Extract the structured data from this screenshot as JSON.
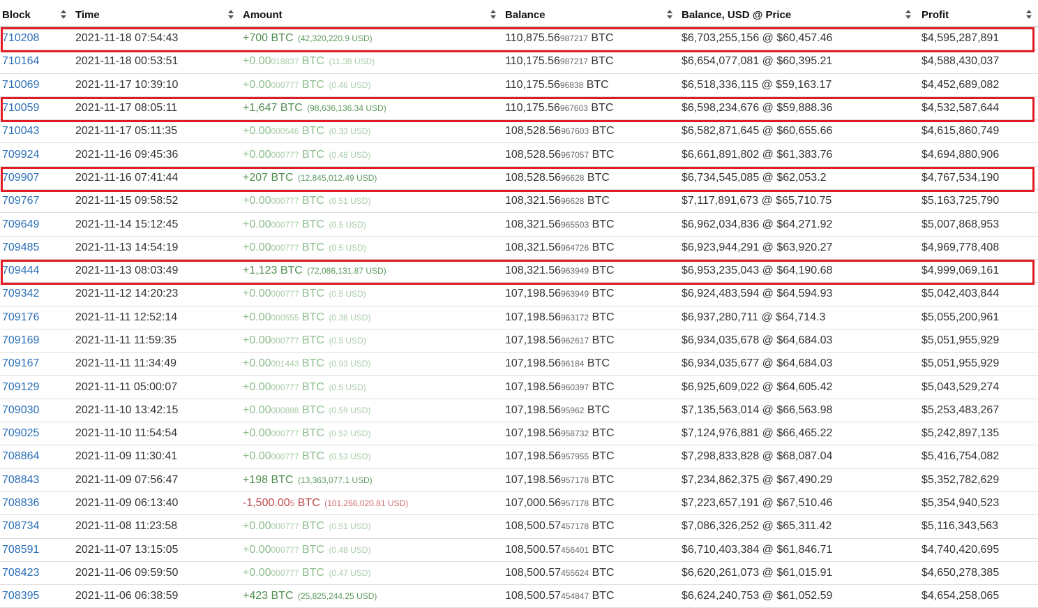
{
  "columns": [
    {
      "key": "block",
      "label": "Block"
    },
    {
      "key": "time",
      "label": "Time"
    },
    {
      "key": "amount",
      "label": "Amount"
    },
    {
      "key": "balance",
      "label": "Balance"
    },
    {
      "key": "usd",
      "label": "Balance, USD @ Price"
    },
    {
      "key": "profit",
      "label": "Profit"
    }
  ],
  "colors": {
    "link": "#2a6fb8",
    "positive": "#4f8d4f",
    "negative": "#c0494c",
    "highlight": "#e01b24"
  },
  "rows": [
    {
      "block": "710208",
      "time": "2021-11-18 07:54:43",
      "amt_main": "+700",
      "amt_small": "",
      "amt_unit": " BTC",
      "amt_usd": "(42,320,220.9 USD)",
      "kind": "big-pos",
      "bal_main": "110,875.56",
      "bal_small": "987217",
      "bal_unit": " BTC",
      "usd": "$6,703,255,156 @ $60,457.46",
      "profit": "$4,595,287,891",
      "highlighted": true
    },
    {
      "block": "710164",
      "time": "2021-11-18 00:53:51",
      "amt_main": "+0.00",
      "amt_small": "018837",
      "amt_unit": " BTC",
      "amt_usd": "(11.38 USD)",
      "kind": "dust-pos",
      "bal_main": "110,175.56",
      "bal_small": "987217",
      "bal_unit": " BTC",
      "usd": "$6,654,077,081 @ $60,395.21",
      "profit": "$4,588,430,037",
      "highlighted": false
    },
    {
      "block": "710069",
      "time": "2021-11-17 10:39:10",
      "amt_main": "+0.00",
      "amt_small": "000777",
      "amt_unit": " BTC",
      "amt_usd": "(0.46 USD)",
      "kind": "dust-pos",
      "bal_main": "110,175.56",
      "bal_small": "96838",
      "bal_unit": " BTC",
      "usd": "$6,518,336,115 @ $59,163.17",
      "profit": "$4,452,689,082",
      "highlighted": false
    },
    {
      "block": "710059",
      "time": "2021-11-17 08:05:11",
      "amt_main": "+1,647",
      "amt_small": "",
      "amt_unit": " BTC",
      "amt_usd": "(98,636,136.34 USD)",
      "kind": "big-pos",
      "bal_main": "110,175.56",
      "bal_small": "967603",
      "bal_unit": " BTC",
      "usd": "$6,598,234,676 @ $59,888.36",
      "profit": "$4,532,587,644",
      "highlighted": true
    },
    {
      "block": "710043",
      "time": "2021-11-17 05:11:35",
      "amt_main": "+0.00",
      "amt_small": "000546",
      "amt_unit": " BTC",
      "amt_usd": "(0.33 USD)",
      "kind": "dust-pos",
      "bal_main": "108,528.56",
      "bal_small": "967603",
      "bal_unit": " BTC",
      "usd": "$6,582,871,645 @ $60,655.66",
      "profit": "$4,615,860,749",
      "highlighted": false
    },
    {
      "block": "709924",
      "time": "2021-11-16 09:45:36",
      "amt_main": "+0.00",
      "amt_small": "000777",
      "amt_unit": " BTC",
      "amt_usd": "(0.48 USD)",
      "kind": "dust-pos",
      "bal_main": "108,528.56",
      "bal_small": "967057",
      "bal_unit": " BTC",
      "usd": "$6,661,891,802 @ $61,383.76",
      "profit": "$4,694,880,906",
      "highlighted": false
    },
    {
      "block": "709907",
      "time": "2021-11-16 07:41:44",
      "amt_main": "+207",
      "amt_small": "",
      "amt_unit": " BTC",
      "amt_usd": "(12,845,012.49 USD)",
      "kind": "big-pos",
      "bal_main": "108,528.56",
      "bal_small": "96628",
      "bal_unit": " BTC",
      "usd": "$6,734,545,085 @ $62,053.2",
      "profit": "$4,767,534,190",
      "highlighted": true
    },
    {
      "block": "709767",
      "time": "2021-11-15 09:58:52",
      "amt_main": "+0.00",
      "amt_small": "000777",
      "amt_unit": " BTC",
      "amt_usd": "(0.51 USD)",
      "kind": "dust-pos",
      "bal_main": "108,321.56",
      "bal_small": "96628",
      "bal_unit": " BTC",
      "usd": "$7,117,891,673 @ $65,710.75",
      "profit": "$5,163,725,790",
      "highlighted": false
    },
    {
      "block": "709649",
      "time": "2021-11-14 15:12:45",
      "amt_main": "+0.00",
      "amt_small": "000777",
      "amt_unit": " BTC",
      "amt_usd": "(0.5 USD)",
      "kind": "dust-pos",
      "bal_main": "108,321.56",
      "bal_small": "965503",
      "bal_unit": " BTC",
      "usd": "$6,962,034,836 @ $64,271.92",
      "profit": "$5,007,868,953",
      "highlighted": false
    },
    {
      "block": "709485",
      "time": "2021-11-13 14:54:19",
      "amt_main": "+0.00",
      "amt_small": "000777",
      "amt_unit": " BTC",
      "amt_usd": "(0.5 USD)",
      "kind": "dust-pos",
      "bal_main": "108,321.56",
      "bal_small": "964726",
      "bal_unit": " BTC",
      "usd": "$6,923,944,291 @ $63,920.27",
      "profit": "$4,969,778,408",
      "highlighted": false
    },
    {
      "block": "709444",
      "time": "2021-11-13 08:03:49",
      "amt_main": "+1,123",
      "amt_small": "",
      "amt_unit": " BTC",
      "amt_usd": "(72,086,131.87 USD)",
      "kind": "big-pos",
      "bal_main": "108,321.56",
      "bal_small": "963949",
      "bal_unit": " BTC",
      "usd": "$6,953,235,043 @ $64,190.68",
      "profit": "$4,999,069,161",
      "highlighted": true
    },
    {
      "block": "709342",
      "time": "2021-11-12 14:20:23",
      "amt_main": "+0.00",
      "amt_small": "000777",
      "amt_unit": " BTC",
      "amt_usd": "(0.5 USD)",
      "kind": "dust-pos",
      "bal_main": "107,198.56",
      "bal_small": "963949",
      "bal_unit": " BTC",
      "usd": "$6,924,483,594 @ $64,594.93",
      "profit": "$5,042,403,844",
      "highlighted": false
    },
    {
      "block": "709176",
      "time": "2021-11-11 12:52:14",
      "amt_main": "+0.00",
      "amt_small": "000555",
      "amt_unit": " BTC",
      "amt_usd": "(0.36 USD)",
      "kind": "dust-pos",
      "bal_main": "107,198.56",
      "bal_small": "963172",
      "bal_unit": " BTC",
      "usd": "$6,937,280,711 @ $64,714.3",
      "profit": "$5,055,200,961",
      "highlighted": false
    },
    {
      "block": "709169",
      "time": "2021-11-11 11:59:35",
      "amt_main": "+0.00",
      "amt_small": "000777",
      "amt_unit": " BTC",
      "amt_usd": "(0.5 USD)",
      "kind": "dust-pos",
      "bal_main": "107,198.56",
      "bal_small": "962617",
      "bal_unit": " BTC",
      "usd": "$6,934,035,678 @ $64,684.03",
      "profit": "$5,051,955,929",
      "highlighted": false
    },
    {
      "block": "709167",
      "time": "2021-11-11 11:34:49",
      "amt_main": "+0.00",
      "amt_small": "001443",
      "amt_unit": " BTC",
      "amt_usd": "(0.93 USD)",
      "kind": "dust-pos",
      "bal_main": "107,198.56",
      "bal_small": "96184",
      "bal_unit": " BTC",
      "usd": "$6,934,035,677 @ $64,684.03",
      "profit": "$5,051,955,929",
      "highlighted": false
    },
    {
      "block": "709129",
      "time": "2021-11-11 05:00:07",
      "amt_main": "+0.00",
      "amt_small": "000777",
      "amt_unit": " BTC",
      "amt_usd": "(0.5 USD)",
      "kind": "dust-pos",
      "bal_main": "107,198.56",
      "bal_small": "960397",
      "bal_unit": " BTC",
      "usd": "$6,925,609,022 @ $64,605.42",
      "profit": "$5,043,529,274",
      "highlighted": false
    },
    {
      "block": "709030",
      "time": "2021-11-10 13:42:15",
      "amt_main": "+0.00",
      "amt_small": "000888",
      "amt_unit": " BTC",
      "amt_usd": "(0.59 USD)",
      "kind": "dust-pos",
      "bal_main": "107,198.56",
      "bal_small": "95962",
      "bal_unit": " BTC",
      "usd": "$7,135,563,014 @ $66,563.98",
      "profit": "$5,253,483,267",
      "highlighted": false
    },
    {
      "block": "709025",
      "time": "2021-11-10 11:54:54",
      "amt_main": "+0.00",
      "amt_small": "000777",
      "amt_unit": " BTC",
      "amt_usd": "(0.52 USD)",
      "kind": "dust-pos",
      "bal_main": "107,198.56",
      "bal_small": "958732",
      "bal_unit": " BTC",
      "usd": "$7,124,976,881 @ $66,465.22",
      "profit": "$5,242,897,135",
      "highlighted": false
    },
    {
      "block": "708864",
      "time": "2021-11-09 11:30:41",
      "amt_main": "+0.00",
      "amt_small": "000777",
      "amt_unit": " BTC",
      "amt_usd": "(0.53 USD)",
      "kind": "dust-pos",
      "bal_main": "107,198.56",
      "bal_small": "957955",
      "bal_unit": " BTC",
      "usd": "$7,298,833,828 @ $68,087.04",
      "profit": "$5,416,754,082",
      "highlighted": false
    },
    {
      "block": "708843",
      "time": "2021-11-09 07:56:47",
      "amt_main": "+198",
      "amt_small": "",
      "amt_unit": " BTC",
      "amt_usd": "(13,363,077.1 USD)",
      "kind": "big-pos",
      "bal_main": "107,198.56",
      "bal_small": "957178",
      "bal_unit": " BTC",
      "usd": "$7,234,862,375 @ $67,490.29",
      "profit": "$5,352,782,629",
      "highlighted": false
    },
    {
      "block": "708836",
      "time": "2021-11-09 06:13:40",
      "amt_main": "-1,500.00",
      "amt_small": "5",
      "amt_unit": " BTC",
      "amt_usd": "(101,266,020.81 USD)",
      "kind": "neg",
      "bal_main": "107,000.56",
      "bal_small": "957178",
      "bal_unit": " BTC",
      "usd": "$7,223,657,191 @ $67,510.46",
      "profit": "$5,354,940,523",
      "highlighted": false
    },
    {
      "block": "708734",
      "time": "2021-11-08 11:23:58",
      "amt_main": "+0.00",
      "amt_small": "000777",
      "amt_unit": " BTC",
      "amt_usd": "(0.51 USD)",
      "kind": "dust-pos",
      "bal_main": "108,500.57",
      "bal_small": "457178",
      "bal_unit": " BTC",
      "usd": "$7,086,326,252 @ $65,311.42",
      "profit": "$5,116,343,563",
      "highlighted": false
    },
    {
      "block": "708591",
      "time": "2021-11-07 13:15:05",
      "amt_main": "+0.00",
      "amt_small": "000777",
      "amt_unit": " BTC",
      "amt_usd": "(0.48 USD)",
      "kind": "dust-pos",
      "bal_main": "108,500.57",
      "bal_small": "456401",
      "bal_unit": " BTC",
      "usd": "$6,710,403,384 @ $61,846.71",
      "profit": "$4,740,420,695",
      "highlighted": false
    },
    {
      "block": "708423",
      "time": "2021-11-06 09:59:50",
      "amt_main": "+0.00",
      "amt_small": "000777",
      "amt_unit": " BTC",
      "amt_usd": "(0.47 USD)",
      "kind": "dust-pos",
      "bal_main": "108,500.57",
      "bal_small": "455624",
      "bal_unit": " BTC",
      "usd": "$6,620,261,073 @ $61,015.91",
      "profit": "$4,650,278,385",
      "highlighted": false
    },
    {
      "block": "708395",
      "time": "2021-11-06 06:38:59",
      "amt_main": "+423",
      "amt_small": "",
      "amt_unit": " BTC",
      "amt_usd": "(25,825,244.25 USD)",
      "kind": "big-pos",
      "bal_main": "108,500.57",
      "bal_small": "454847",
      "bal_unit": " BTC",
      "usd": "$6,624,240,753 @ $61,052.59",
      "profit": "$4,654,258,065",
      "highlighted": false
    }
  ]
}
